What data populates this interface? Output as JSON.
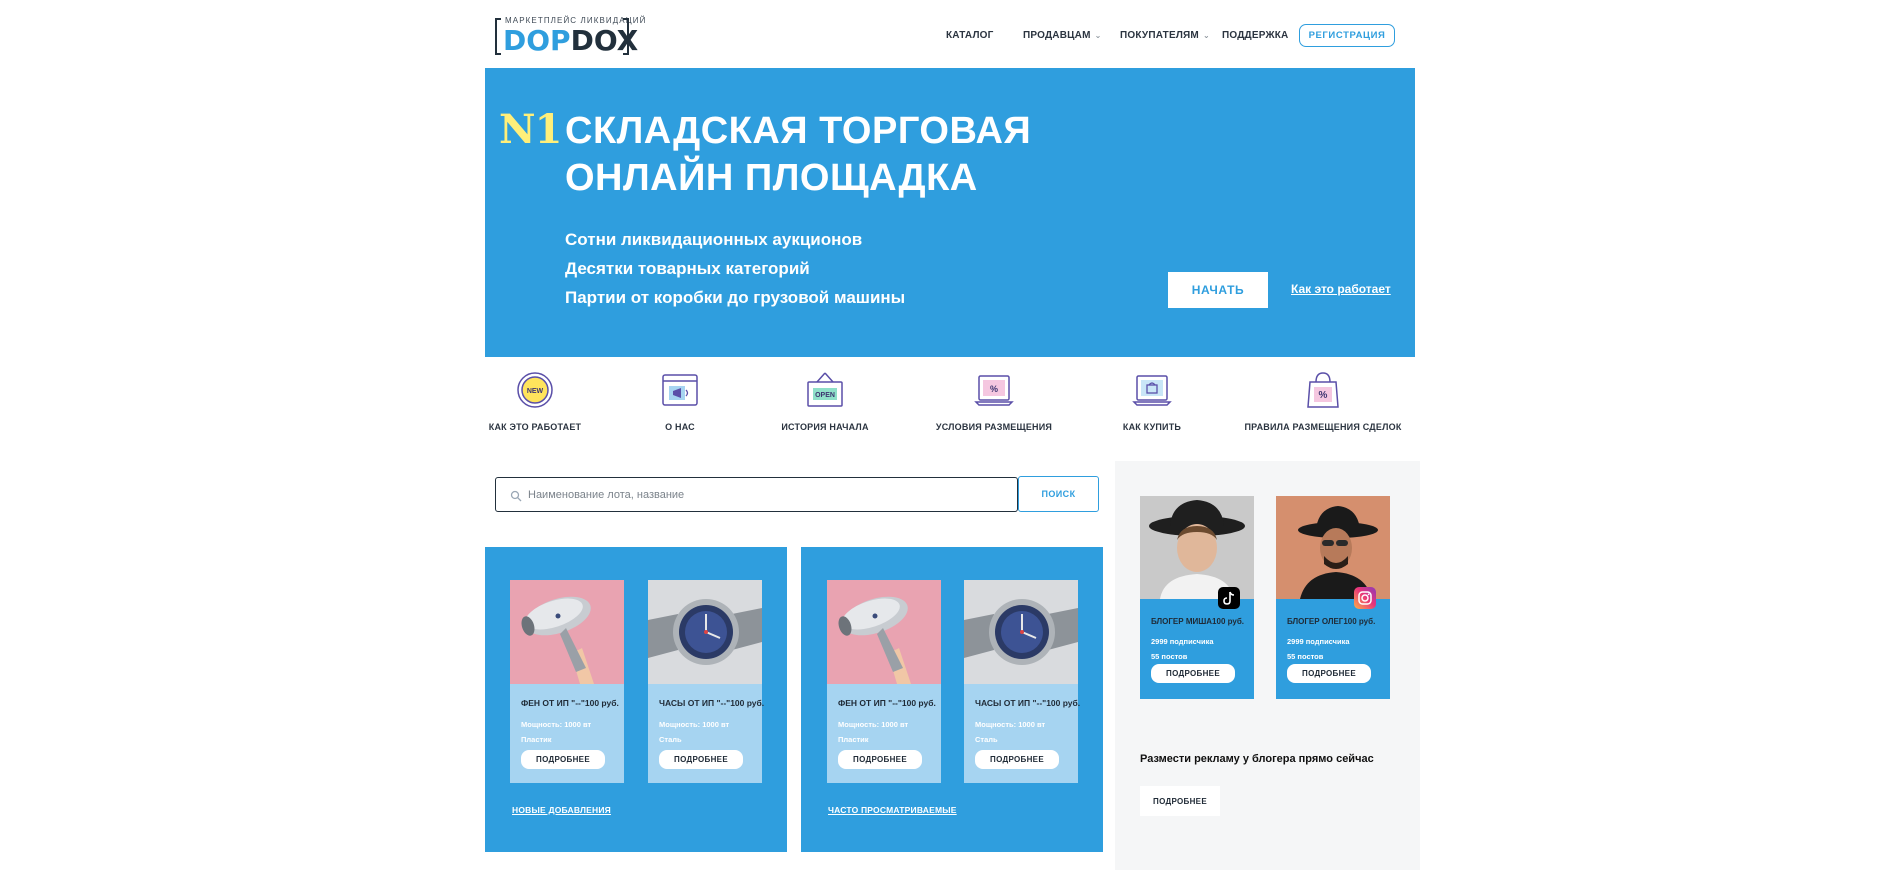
{
  "header": {
    "logo_tag": "МАРКЕТПЛЕЙС  ЛИКВИДАЦИЙ",
    "logo_word_a": "DOP",
    "logo_word_b": "DOX",
    "nav": [
      {
        "label": "КАТАЛОГ",
        "has_dropdown": false
      },
      {
        "label": "ПРОДАВЦАМ",
        "has_dropdown": true
      },
      {
        "label": "ПОКУПАТЕЛЯМ",
        "has_dropdown": true
      },
      {
        "label": "ПОДДЕРЖКА",
        "has_dropdown": false
      }
    ],
    "register_label": "РЕГИСТРАЦИЯ"
  },
  "hero": {
    "badge": "N1",
    "title_line1": "СКЛАДСКАЯ ТОРГОВАЯ",
    "title_line2": "ОНЛАЙН ПЛОЩАДКА",
    "lines": [
      "Сотни ликвидационных аукционов",
      "Десятки товарных категорий",
      "Партии от коробки до грузовой машины"
    ],
    "start_label": "НАЧАТЬ",
    "how_link": "Как это работает"
  },
  "features": [
    {
      "icon": "new-badge-icon",
      "label": "КАК ЭТО РАБОТАЕТ"
    },
    {
      "icon": "browser-megaphone-icon",
      "label": "О НАС"
    },
    {
      "icon": "open-sign-icon",
      "label": "ИСТОРИЯ НАЧАЛА"
    },
    {
      "icon": "laptop-percent-icon",
      "label": "УСЛОВИЯ РАЗМЕЩЕНИЯ"
    },
    {
      "icon": "laptop-cart-icon",
      "label": "КАК КУПИТЬ"
    },
    {
      "icon": "shopping-bag-percent-icon",
      "label": "ПРАВИЛА РАЗМЕЩЕНИЯ СДЕЛОК"
    }
  ],
  "search": {
    "placeholder": "Наименование лота, название",
    "value": "",
    "button_label": "ПОИСК"
  },
  "panels": [
    {
      "link": "НОВЫЕ ДОБАВЛЕНИЯ",
      "products": [
        {
          "title": "ФЕН ОТ ИП \"--\"100 руб.",
          "meta1": "Мощность: 1000 вт",
          "meta2": "Пластик",
          "button": "ПОДРОБНЕЕ"
        },
        {
          "title": "ЧАСЫ ОТ ИП \"--\"100 руб.",
          "meta1": "Мощность: 1000 вт",
          "meta2": "Сталь",
          "button": "ПОДРОБНЕЕ"
        }
      ]
    },
    {
      "link": "ЧАСТО ПРОСМАТРИВАЕМЫЕ",
      "products": [
        {
          "title": "ФЕН ОТ ИП \"--\"100 руб.",
          "meta1": "Мощность: 1000 вт",
          "meta2": "Пластик",
          "button": "ПОДРОБНЕЕ"
        },
        {
          "title": "ЧАСЫ ОТ ИП \"--\"100 руб.",
          "meta1": "Мощность: 1000 вт",
          "meta2": "Сталь",
          "button": "ПОДРОБНЕЕ"
        }
      ]
    }
  ],
  "bloggers": [
    {
      "name": "БЛОГЕР МИША100 руб.",
      "followers": "2999 подписчика",
      "posts": "55 постов",
      "button": "ПОДРОБНЕЕ",
      "social": "tiktok-icon"
    },
    {
      "name": "БЛОГЕР ОЛЕГ100 руб.",
      "followers": "2999 подписчика",
      "posts": "55 постов",
      "button": "ПОДРОБНЕЕ",
      "social": "instagram-icon"
    }
  ],
  "promo": {
    "text": "Размести рекламу у блогера прямо сейчас",
    "button": "ПОДРОБНЕЕ"
  },
  "colors": {
    "brand_blue": "#2f9ede",
    "card_light_blue": "#a6d4f1",
    "badge_yellow": "#ffef7a",
    "text_dark": "#1f2a36"
  }
}
